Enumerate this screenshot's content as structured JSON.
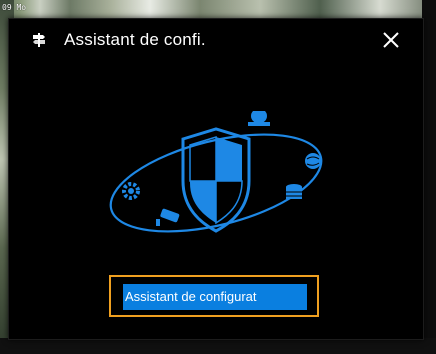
{
  "background": {
    "timestamp": "09 Mo"
  },
  "dialog": {
    "title": "Assistant de confi.",
    "close_icon": "close-icon",
    "illustration_icon": "security-shield-orbit-icon",
    "action_button_label": "Assistant de configurat",
    "colors": {
      "accent": "#1e88e5",
      "button": "#0a7fe0",
      "highlight_frame": "#f0a020",
      "background": "#000000"
    }
  }
}
